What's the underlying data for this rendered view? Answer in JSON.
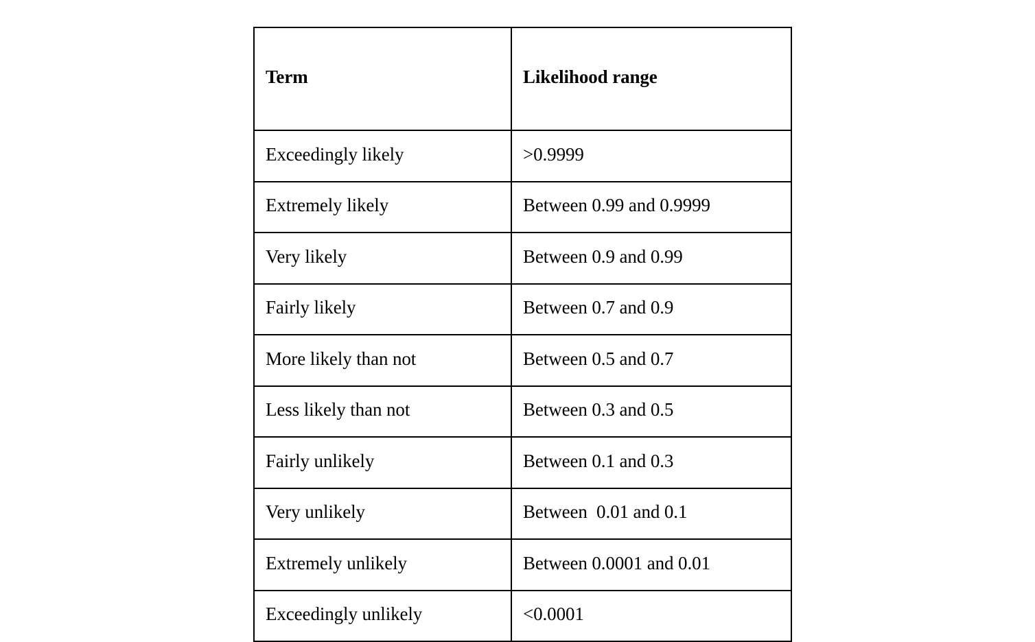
{
  "document": {
    "background_color": "#ffffff",
    "text_color": "#000000",
    "border_color": "#000000"
  },
  "table": {
    "name": "likelihood-terminology-table",
    "columns": [
      {
        "key": "term",
        "header": "Term"
      },
      {
        "key": "range",
        "header": "Likelihood range"
      }
    ],
    "rows": [
      {
        "term": "Exceedingly likely",
        "range": ">0.9999"
      },
      {
        "term": "Extremely likely",
        "range": "Between 0.99 and 0.9999"
      },
      {
        "term": "Very likely",
        "range": "Between 0.9 and 0.99"
      },
      {
        "term": "Fairly likely",
        "range": "Between 0.7 and 0.9"
      },
      {
        "term": "More likely than not",
        "range": "Between 0.5 and 0.7"
      },
      {
        "term": "Less likely than not",
        "range": "Between 0.3 and 0.5"
      },
      {
        "term": "Fairly unlikely",
        "range": "Between 0.1 and 0.3"
      },
      {
        "term": "Very unlikely",
        "range": "Between  0.01 and 0.1"
      },
      {
        "term": "Extremely unlikely",
        "range": "Between 0.0001 and 0.01"
      },
      {
        "term": "Exceedingly unlikely",
        "range": "<0.0001"
      }
    ]
  }
}
